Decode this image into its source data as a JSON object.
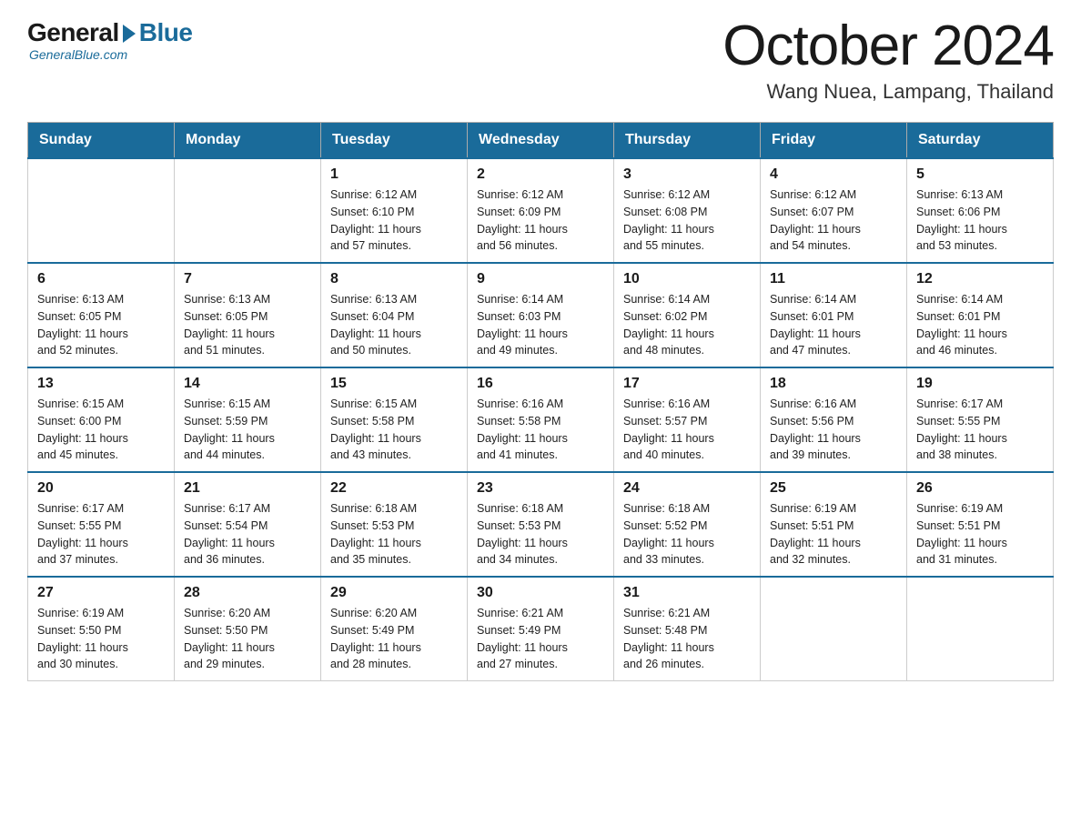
{
  "logo": {
    "general": "General",
    "blue": "Blue",
    "tagline": "GeneralBlue.com"
  },
  "title": "October 2024",
  "location": "Wang Nuea, Lampang, Thailand",
  "headers": [
    "Sunday",
    "Monday",
    "Tuesday",
    "Wednesday",
    "Thursday",
    "Friday",
    "Saturday"
  ],
  "weeks": [
    [
      {
        "day": "",
        "info": ""
      },
      {
        "day": "",
        "info": ""
      },
      {
        "day": "1",
        "info": "Sunrise: 6:12 AM\nSunset: 6:10 PM\nDaylight: 11 hours\nand 57 minutes."
      },
      {
        "day": "2",
        "info": "Sunrise: 6:12 AM\nSunset: 6:09 PM\nDaylight: 11 hours\nand 56 minutes."
      },
      {
        "day": "3",
        "info": "Sunrise: 6:12 AM\nSunset: 6:08 PM\nDaylight: 11 hours\nand 55 minutes."
      },
      {
        "day": "4",
        "info": "Sunrise: 6:12 AM\nSunset: 6:07 PM\nDaylight: 11 hours\nand 54 minutes."
      },
      {
        "day": "5",
        "info": "Sunrise: 6:13 AM\nSunset: 6:06 PM\nDaylight: 11 hours\nand 53 minutes."
      }
    ],
    [
      {
        "day": "6",
        "info": "Sunrise: 6:13 AM\nSunset: 6:05 PM\nDaylight: 11 hours\nand 52 minutes."
      },
      {
        "day": "7",
        "info": "Sunrise: 6:13 AM\nSunset: 6:05 PM\nDaylight: 11 hours\nand 51 minutes."
      },
      {
        "day": "8",
        "info": "Sunrise: 6:13 AM\nSunset: 6:04 PM\nDaylight: 11 hours\nand 50 minutes."
      },
      {
        "day": "9",
        "info": "Sunrise: 6:14 AM\nSunset: 6:03 PM\nDaylight: 11 hours\nand 49 minutes."
      },
      {
        "day": "10",
        "info": "Sunrise: 6:14 AM\nSunset: 6:02 PM\nDaylight: 11 hours\nand 48 minutes."
      },
      {
        "day": "11",
        "info": "Sunrise: 6:14 AM\nSunset: 6:01 PM\nDaylight: 11 hours\nand 47 minutes."
      },
      {
        "day": "12",
        "info": "Sunrise: 6:14 AM\nSunset: 6:01 PM\nDaylight: 11 hours\nand 46 minutes."
      }
    ],
    [
      {
        "day": "13",
        "info": "Sunrise: 6:15 AM\nSunset: 6:00 PM\nDaylight: 11 hours\nand 45 minutes."
      },
      {
        "day": "14",
        "info": "Sunrise: 6:15 AM\nSunset: 5:59 PM\nDaylight: 11 hours\nand 44 minutes."
      },
      {
        "day": "15",
        "info": "Sunrise: 6:15 AM\nSunset: 5:58 PM\nDaylight: 11 hours\nand 43 minutes."
      },
      {
        "day": "16",
        "info": "Sunrise: 6:16 AM\nSunset: 5:58 PM\nDaylight: 11 hours\nand 41 minutes."
      },
      {
        "day": "17",
        "info": "Sunrise: 6:16 AM\nSunset: 5:57 PM\nDaylight: 11 hours\nand 40 minutes."
      },
      {
        "day": "18",
        "info": "Sunrise: 6:16 AM\nSunset: 5:56 PM\nDaylight: 11 hours\nand 39 minutes."
      },
      {
        "day": "19",
        "info": "Sunrise: 6:17 AM\nSunset: 5:55 PM\nDaylight: 11 hours\nand 38 minutes."
      }
    ],
    [
      {
        "day": "20",
        "info": "Sunrise: 6:17 AM\nSunset: 5:55 PM\nDaylight: 11 hours\nand 37 minutes."
      },
      {
        "day": "21",
        "info": "Sunrise: 6:17 AM\nSunset: 5:54 PM\nDaylight: 11 hours\nand 36 minutes."
      },
      {
        "day": "22",
        "info": "Sunrise: 6:18 AM\nSunset: 5:53 PM\nDaylight: 11 hours\nand 35 minutes."
      },
      {
        "day": "23",
        "info": "Sunrise: 6:18 AM\nSunset: 5:53 PM\nDaylight: 11 hours\nand 34 minutes."
      },
      {
        "day": "24",
        "info": "Sunrise: 6:18 AM\nSunset: 5:52 PM\nDaylight: 11 hours\nand 33 minutes."
      },
      {
        "day": "25",
        "info": "Sunrise: 6:19 AM\nSunset: 5:51 PM\nDaylight: 11 hours\nand 32 minutes."
      },
      {
        "day": "26",
        "info": "Sunrise: 6:19 AM\nSunset: 5:51 PM\nDaylight: 11 hours\nand 31 minutes."
      }
    ],
    [
      {
        "day": "27",
        "info": "Sunrise: 6:19 AM\nSunset: 5:50 PM\nDaylight: 11 hours\nand 30 minutes."
      },
      {
        "day": "28",
        "info": "Sunrise: 6:20 AM\nSunset: 5:50 PM\nDaylight: 11 hours\nand 29 minutes."
      },
      {
        "day": "29",
        "info": "Sunrise: 6:20 AM\nSunset: 5:49 PM\nDaylight: 11 hours\nand 28 minutes."
      },
      {
        "day": "30",
        "info": "Sunrise: 6:21 AM\nSunset: 5:49 PM\nDaylight: 11 hours\nand 27 minutes."
      },
      {
        "day": "31",
        "info": "Sunrise: 6:21 AM\nSunset: 5:48 PM\nDaylight: 11 hours\nand 26 minutes."
      },
      {
        "day": "",
        "info": ""
      },
      {
        "day": "",
        "info": ""
      }
    ]
  ]
}
